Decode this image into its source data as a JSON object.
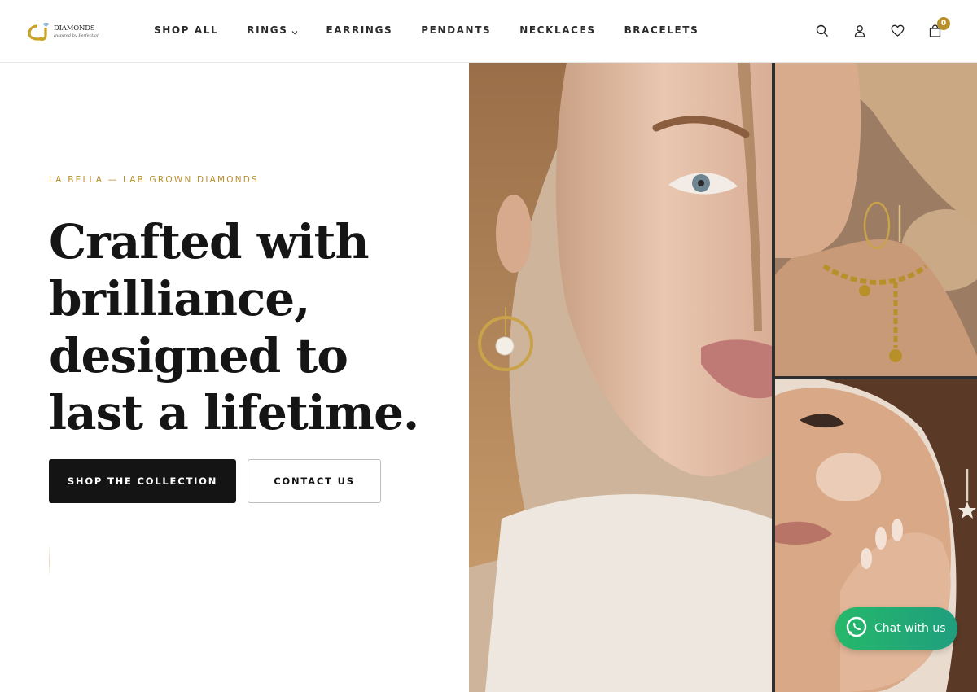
{
  "brand": {
    "name": "DIAMONDS",
    "tagline": "Inspired by Perfection",
    "accent": "#b8902a"
  },
  "nav": {
    "items": [
      {
        "label": "SHOP ALL"
      },
      {
        "label": "RINGS",
        "has_dropdown": true
      },
      {
        "label": "EARRINGS"
      },
      {
        "label": "PENDANTS"
      },
      {
        "label": "NECKLACES"
      },
      {
        "label": "BRACELETS"
      }
    ]
  },
  "header_icons": [
    "search-icon",
    "account-icon",
    "wishlist-icon",
    "cart-icon"
  ],
  "cart": {
    "count": "0"
  },
  "hero": {
    "eyebrow": "LA BELLA — LAB GROWN DIAMONDS",
    "headline": "Crafted with brilliance, designed to last a lifetime.",
    "primary_cta": "SHOP THE COLLECTION",
    "secondary_cta": "CONTACT US"
  },
  "chat": {
    "label": "Chat with us",
    "color": "#25b86a"
  }
}
